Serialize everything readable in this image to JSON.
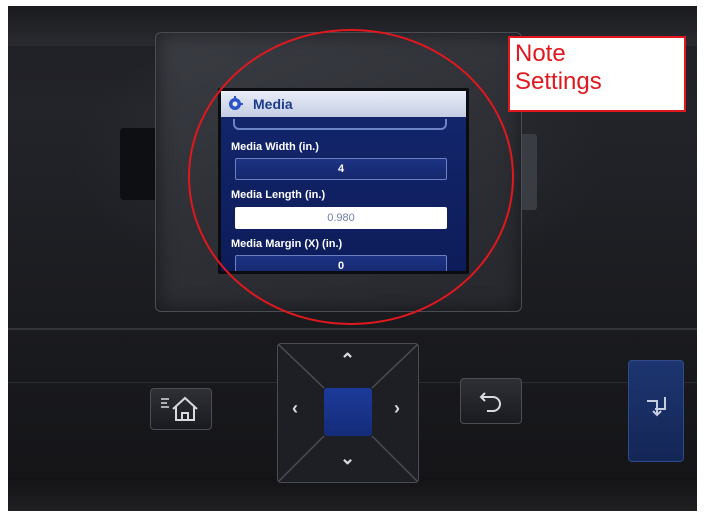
{
  "screen": {
    "title": "Media",
    "fields": [
      {
        "label": "Media Width (in.)",
        "value": "4"
      },
      {
        "label": "Media Length (in.)",
        "value": "0.980"
      },
      {
        "label": "Media Margin (X) (in.)",
        "value": "0"
      }
    ]
  },
  "annotation": {
    "note_line1": "Note",
    "note_line2": "Settings",
    "color": "#e0181e"
  },
  "icons": {
    "header": "gear-icon",
    "home": "home-icon",
    "back": "back-arrow-icon",
    "feed": "feed-icon",
    "nav": [
      "chevron-up-icon",
      "chevron-down-icon",
      "chevron-left-icon",
      "chevron-right-icon"
    ]
  },
  "colors": {
    "screen_background": "#14276e",
    "selected_field": "#ffffff",
    "ok_button": "#1c3a9a"
  }
}
